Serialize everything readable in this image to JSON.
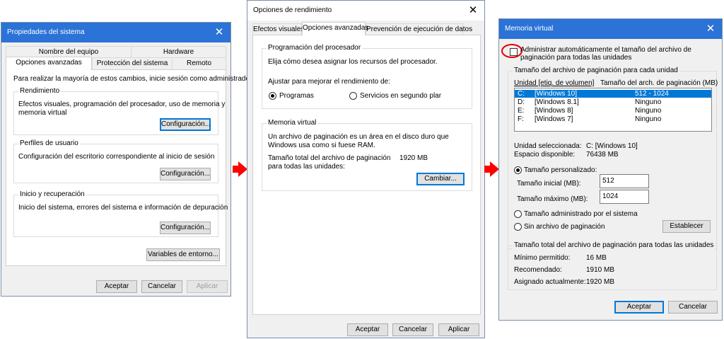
{
  "win1": {
    "title": "Propiedades del sistema",
    "tabs_row1": [
      "Nombre del equipo",
      "Hardware"
    ],
    "tabs_row2": [
      "Opciones avanzadas",
      "Protección del sistema",
      "Remoto"
    ],
    "admin_note": "Para realizar la mayoría de estos cambios, inicie sesión como administrador.",
    "perf": {
      "title": "Rendimiento",
      "desc_line1": "Efectos visuales, programación del procesador, uso de memoria y",
      "desc_line2": "memoria virtual",
      "button": "Configuración..."
    },
    "profiles": {
      "title": "Perfiles de usuario",
      "desc": "Configuración del escritorio correspondiente al inicio de sesión",
      "button": "Configuración..."
    },
    "startup": {
      "title": "Inicio y recuperación",
      "desc": "Inicio del sistema, errores del sistema e información de depuración",
      "button": "Configuración..."
    },
    "env_button": "Variables de entorno...",
    "ok": "Aceptar",
    "cancel": "Cancelar",
    "apply": "Aplicar"
  },
  "win2": {
    "title": "Opciones de rendimiento",
    "tabs": [
      "Efectos visuales",
      "Opciones avanzadas",
      "Prevención de ejecución de datos"
    ],
    "cpu": {
      "title": "Programación del procesador",
      "desc": "Elija cómo desea asignar los recursos del procesador.",
      "adjust": "Ajustar para mejorar el rendimiento de:",
      "opt1": "Programas",
      "opt2": "Servicios en segundo plar"
    },
    "vm": {
      "title": "Memoria virtual",
      "desc_line1": "Un archivo de paginación es un área en el disco duro que",
      "desc_line2": "Windows usa como si fuese RAM.",
      "total_line1": "Tamaño total del archivo de paginación",
      "total_line2": "para todas las unidades:",
      "total_value": "1920 MB",
      "button": "Cambiar..."
    },
    "ok": "Aceptar",
    "cancel": "Cancelar",
    "apply": "Aplicar"
  },
  "win3": {
    "title": "Memoria virtual",
    "auto_line1": "Administrar automáticamente el tamaño del archivo de",
    "auto_line2": "paginación para todas las unidades",
    "group1_title": "Tamaño del archivo de paginación para cada unidad",
    "col_drive": "Unidad [etiq. de volumen]",
    "col_size": "Tamaño del arch. de paginación (MB)",
    "drives": [
      {
        "drive": "C:",
        "label": "[Windows 10]",
        "size": "512 - 1024"
      },
      {
        "drive": "D:",
        "label": "[Windows 8.1]",
        "size": "Ninguno"
      },
      {
        "drive": "E:",
        "label": "[Windows 8]",
        "size": "Ninguno"
      },
      {
        "drive": "F:",
        "label": "[Windows 7]",
        "size": "Ninguno"
      }
    ],
    "selected_label": "Unidad seleccionada:",
    "selected_value": "C:  [Windows 10]",
    "space_label": "Espacio disponible:",
    "space_value": "76438 MB",
    "custom_label": "Tamaño personalizado:",
    "initial_label": "Tamaño inicial (MB):",
    "initial_value": "512",
    "max_label": "Tamaño máximo (MB):",
    "max_value": "1024",
    "system_label": "Tamaño administrado por el sistema",
    "none_label": "Sin archivo de paginación",
    "set_button": "Establecer",
    "group2_title": "Tamaño total del archivo de paginación para todas las unidades",
    "min_label": "Mínimo permitido:",
    "min_value": "16 MB",
    "rec_label": "Recomendado:",
    "rec_value": "1910 MB",
    "cur_label": "Asignado actualmente:",
    "cur_value": "1920 MB",
    "ok": "Aceptar",
    "cancel": "Cancelar"
  },
  "colors": {
    "arrow": "#ff0000",
    "highlight_circle": "#e00000",
    "selection": "#0078d7",
    "titlebar_active": "#2b73d6"
  }
}
